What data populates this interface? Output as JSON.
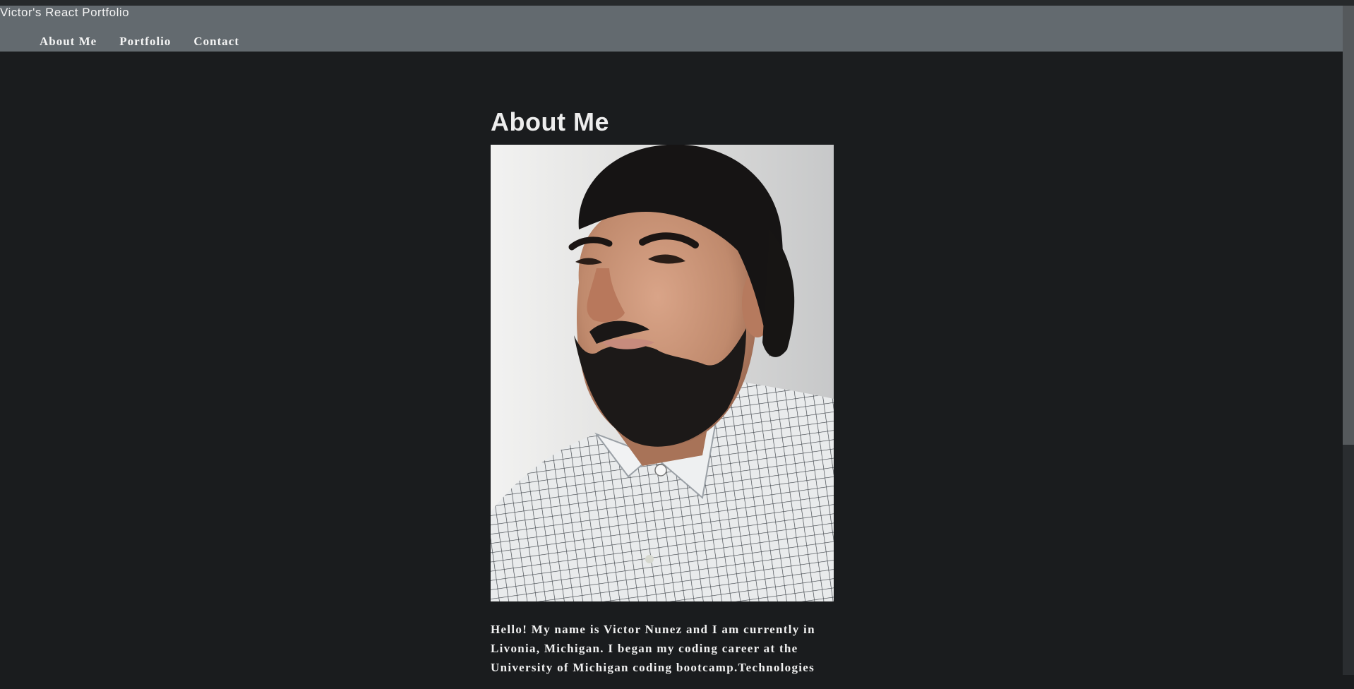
{
  "header": {
    "site_title": "Victor's React Portfolio",
    "nav": [
      {
        "label": "About Me"
      },
      {
        "label": "Portfolio"
      },
      {
        "label": "Contact"
      }
    ]
  },
  "main": {
    "title": "About Me",
    "photo_alt": "Portrait of Victor Nunez",
    "bio": "Hello! My name is Victor Nunez and I am currently in Livonia, Michigan. I began my coding career at the University of Michigan coding bootcamp.Technologies"
  },
  "colors": {
    "background": "#1a1c1e",
    "header": "#636a6f",
    "text": "#f1f1f1"
  }
}
